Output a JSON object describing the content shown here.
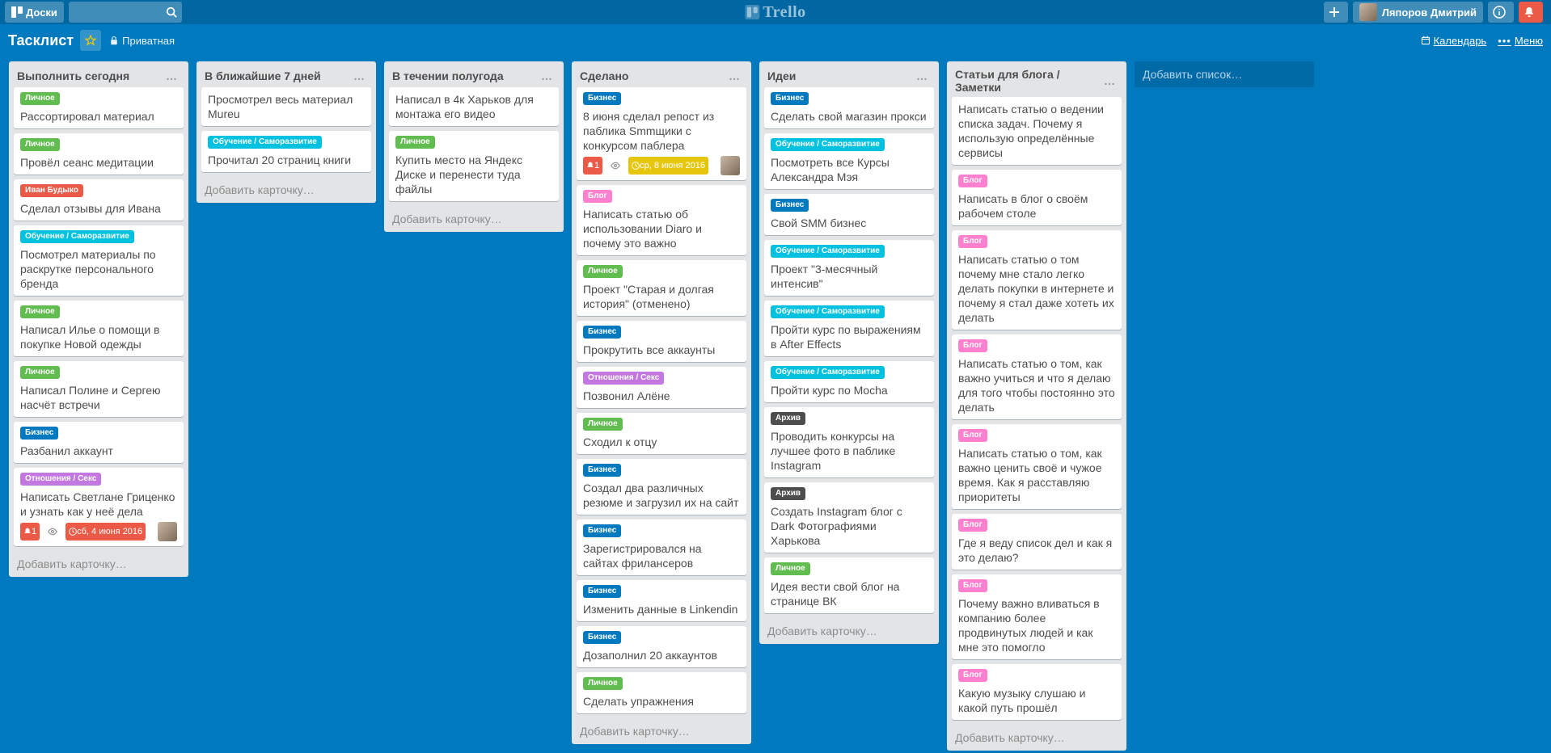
{
  "header": {
    "boards_button": "Доски",
    "user_name": "Ляпоров Дмитрий",
    "logo_text": "Trello"
  },
  "board_header": {
    "title": "Тасклист",
    "visibility": "Приватная",
    "calendar": "Календарь",
    "menu": "Меню"
  },
  "labels": {
    "green": "Личное",
    "red": "Иван Будыко",
    "cyan": "Обучение / Саморазвитие",
    "blue": "Бизнес",
    "purple": "Отношения / Секс",
    "black": "Архив",
    "pink": "Блог"
  },
  "add_card": "Добавить карточку…",
  "add_list": "Добавить список…",
  "lists": [
    {
      "title": "Выполнить сегодня",
      "cards": [
        {
          "labels": [
            "green"
          ],
          "text": "Рассортировал материал"
        },
        {
          "labels": [
            "green"
          ],
          "text": "Провёл сеанс медитации"
        },
        {
          "labels": [
            "red"
          ],
          "text": "Сделал отзывы для Ивана"
        },
        {
          "labels": [
            "cyan"
          ],
          "text": "Посмотрел материалы по раскрутке персонального бренда"
        },
        {
          "labels": [
            "green"
          ],
          "text": "Написал Илье о помощи в покупке Новой одежды"
        },
        {
          "labels": [
            "green"
          ],
          "text": "Написал Полине и Сергею насчёт встречи"
        },
        {
          "labels": [
            "blue"
          ],
          "text": "Разбанил аккаунт"
        },
        {
          "labels": [
            "purple"
          ],
          "text": "Написать Светлане Гриценко и узнать как у неё дела",
          "badges": {
            "notif": "1",
            "watch": true,
            "due": "сб, 4 июня 2016",
            "due_style": "badge-due",
            "member": true
          }
        }
      ]
    },
    {
      "title": "В ближайшие 7 дней",
      "cards": [
        {
          "labels": [],
          "text": "Просмотрел весь материал Mureu"
        },
        {
          "labels": [
            "cyan"
          ],
          "text": "Прочитал 20 страниц книги"
        }
      ]
    },
    {
      "title": "В течении полугода",
      "cards": [
        {
          "labels": [],
          "text": "Написал в 4к Харьков для монтажа его видео"
        },
        {
          "labels": [
            "green"
          ],
          "text": "Купить место на Яндекс Диске и перенести туда файлы"
        }
      ]
    },
    {
      "title": "Сделано",
      "cards": [
        {
          "labels": [
            "blue"
          ],
          "text": "8 июня сделал репост из паблика Smmщики с конкурсом паблера",
          "badges": {
            "notif": "1",
            "watch": true,
            "due": "ср, 8 июня 2016",
            "due_style": "badge-due-soft",
            "member": true
          }
        },
        {
          "labels": [
            "pink"
          ],
          "text": "Написать статью об использовании Diaro и почему это важно"
        },
        {
          "labels": [
            "green"
          ],
          "text": "Проект \"Старая и долгая история\" (отменено)"
        },
        {
          "labels": [
            "blue"
          ],
          "text": "Прокрутить все аккаунты"
        },
        {
          "labels": [
            "purple"
          ],
          "text": "Позвонил Алёне"
        },
        {
          "labels": [
            "green"
          ],
          "text": "Сходил к отцу"
        },
        {
          "labels": [
            "blue"
          ],
          "text": "Создал два различных резюме и загрузил их на сайт"
        },
        {
          "labels": [
            "blue"
          ],
          "text": "Зарегистрировался на сайтах фрилансеров"
        },
        {
          "labels": [
            "blue"
          ],
          "text": "Изменить данные в Linkendin"
        },
        {
          "labels": [
            "blue"
          ],
          "text": "Дозаполнил 20 аккаунтов"
        },
        {
          "labels": [
            "green"
          ],
          "text": "Сделать упражнения"
        }
      ]
    },
    {
      "title": "Идеи",
      "cards": [
        {
          "labels": [
            "blue"
          ],
          "text": "Сделать свой магазин прокси"
        },
        {
          "labels": [
            "cyan"
          ],
          "text": "Посмотреть все Курсы Александра Мэя"
        },
        {
          "labels": [
            "blue"
          ],
          "text": "Свой SMM бизнес"
        },
        {
          "labels": [
            "cyan"
          ],
          "text": "Проект \"3-месячный интенсив\""
        },
        {
          "labels": [
            "cyan"
          ],
          "text": "Пройти курс по выражениям в After Effects"
        },
        {
          "labels": [
            "cyan"
          ],
          "text": "Пройти курс по Mocha"
        },
        {
          "labels": [
            "black"
          ],
          "text": "Проводить конкурсы на лучшее фото в паблике Instagram"
        },
        {
          "labels": [
            "black"
          ],
          "text": "Создать Instagram блог с Dark Фотографиями Харькова"
        },
        {
          "labels": [
            "green"
          ],
          "text": "Идея вести свой блог на странице ВК"
        }
      ]
    },
    {
      "title": "Статьи для блога / Заметки",
      "cards": [
        {
          "labels": [],
          "text": "Написать статью о ведении списка задач. Почему я использую определённые сервисы"
        },
        {
          "labels": [
            "pink"
          ],
          "text": "Написать в блог о своём рабочем столе"
        },
        {
          "labels": [
            "pink"
          ],
          "text": "Написать статью о том почему мне стало легко делать покупки в интернете и почему я стал даже хотеть их делать"
        },
        {
          "labels": [
            "pink"
          ],
          "text": "Написать статью о том, как важно учиться и что я делаю для того чтобы постоянно это делать"
        },
        {
          "labels": [
            "pink"
          ],
          "text": "Написать статью о том, как важно ценить своё и чужое время. Как я расставляю приоритеты"
        },
        {
          "labels": [
            "pink"
          ],
          "text": "Где я веду список дел и как я это делаю?"
        },
        {
          "labels": [
            "pink"
          ],
          "text": "Почему важно вливаться в компанию более продвинутых людей и как мне это помогло"
        },
        {
          "labels": [
            "pink"
          ],
          "text": "Какую музыку слушаю и какой путь прошёл"
        }
      ]
    }
  ]
}
